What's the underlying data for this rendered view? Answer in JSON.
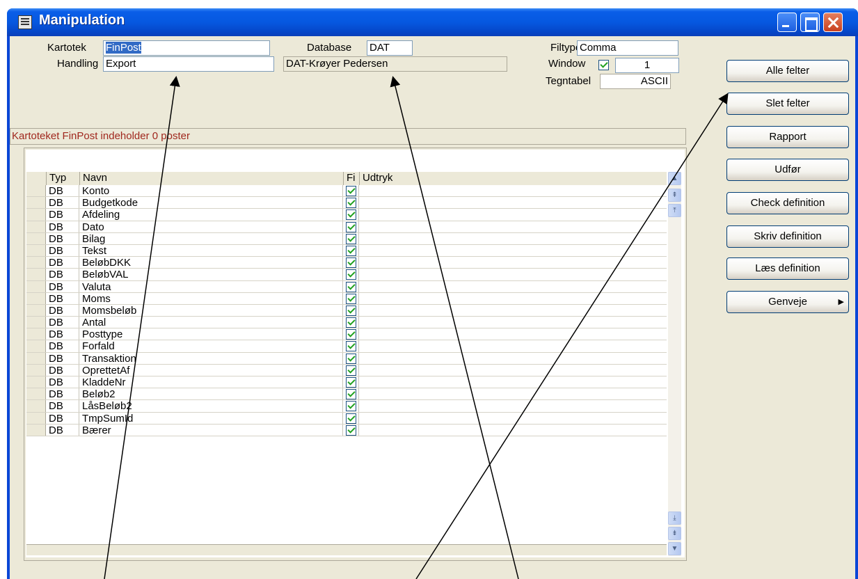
{
  "window": {
    "title": "Manipulation"
  },
  "form": {
    "kartotek_label": "Kartotek",
    "kartotek_value": "FinPost",
    "handling_label": "Handling",
    "handling_value": "Export",
    "database_label": "Database",
    "database_value": "DAT",
    "database_name": "DAT-Krøyer Pedersen",
    "filtype_label": "Filtype",
    "filtype_value": "Comma",
    "window_label": "Window",
    "window_checked": true,
    "window_value": "1",
    "tegntabel_label": "Tegntabel",
    "tegntabel_value": "ASCII"
  },
  "status_text": "Kartoteket FinPost indeholder 0 poster",
  "grid": {
    "headers": {
      "typ": "Typ",
      "navn": "Navn",
      "fi": "Fi",
      "udtryk": "Udtryk"
    },
    "rows": [
      {
        "typ": "DB",
        "navn": "Konto",
        "fi": true,
        "udtryk": ""
      },
      {
        "typ": "DB",
        "navn": "Budgetkode",
        "fi": true,
        "udtryk": ""
      },
      {
        "typ": "DB",
        "navn": "Afdeling",
        "fi": true,
        "udtryk": ""
      },
      {
        "typ": "DB",
        "navn": "Dato",
        "fi": true,
        "udtryk": ""
      },
      {
        "typ": "DB",
        "navn": "Bilag",
        "fi": true,
        "udtryk": ""
      },
      {
        "typ": "DB",
        "navn": "Tekst",
        "fi": true,
        "udtryk": ""
      },
      {
        "typ": "DB",
        "navn": "BeløbDKK",
        "fi": true,
        "udtryk": ""
      },
      {
        "typ": "DB",
        "navn": "BeløbVAL",
        "fi": true,
        "udtryk": ""
      },
      {
        "typ": "DB",
        "navn": "Valuta",
        "fi": true,
        "udtryk": ""
      },
      {
        "typ": "DB",
        "navn": "Moms",
        "fi": true,
        "udtryk": ""
      },
      {
        "typ": "DB",
        "navn": "Momsbeløb",
        "fi": true,
        "udtryk": ""
      },
      {
        "typ": "DB",
        "navn": "Antal",
        "fi": true,
        "udtryk": ""
      },
      {
        "typ": "DB",
        "navn": "Posttype",
        "fi": true,
        "udtryk": ""
      },
      {
        "typ": "DB",
        "navn": "Forfald",
        "fi": true,
        "udtryk": ""
      },
      {
        "typ": "DB",
        "navn": "Transaktion",
        "fi": true,
        "udtryk": ""
      },
      {
        "typ": "DB",
        "navn": "OprettetAf",
        "fi": true,
        "udtryk": ""
      },
      {
        "typ": "DB",
        "navn": "KladdeNr",
        "fi": true,
        "udtryk": ""
      },
      {
        "typ": "DB",
        "navn": "Beløb2",
        "fi": true,
        "udtryk": ""
      },
      {
        "typ": "DB",
        "navn": "LåsBeløb2",
        "fi": true,
        "udtryk": ""
      },
      {
        "typ": "DB",
        "navn": "TmpSumId",
        "fi": true,
        "udtryk": ""
      },
      {
        "typ": "DB",
        "navn": "Bærer",
        "fi": true,
        "udtryk": ""
      }
    ]
  },
  "buttons": {
    "alle_felter": "Alle felter",
    "slet_felter": "Slet felter",
    "rapport": "Rapport",
    "udfor": "Udfør",
    "check_definition": "Check definition",
    "skriv_definition": "Skriv definition",
    "laes_definition": "Læs definition",
    "genveje": "Genveje"
  },
  "colors": {
    "titlebar": "#0a5ee8",
    "dialog_bg": "#ece9d8",
    "status_text": "#a0281e",
    "check": "#21a121"
  }
}
